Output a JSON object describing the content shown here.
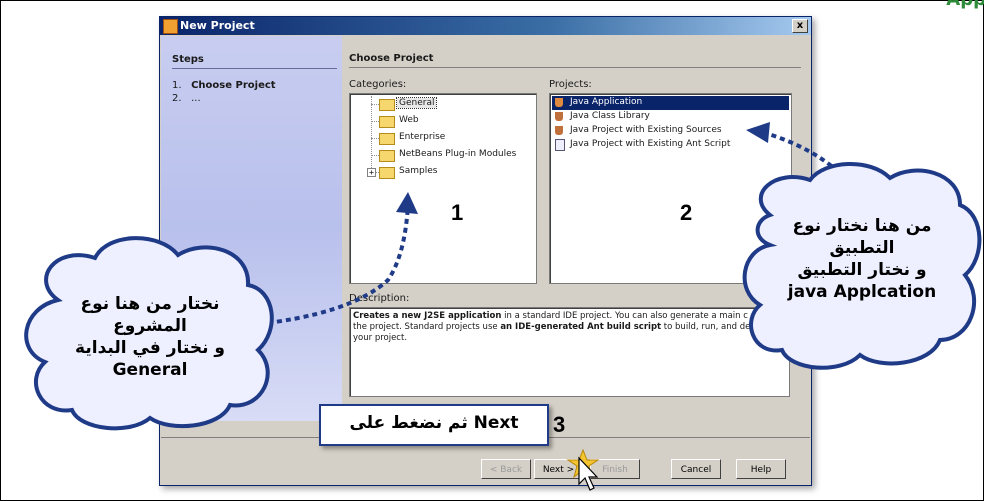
{
  "header_text": "App",
  "dialog": {
    "title": "New Project",
    "close_label": "x"
  },
  "steps": {
    "heading": "Steps",
    "items": [
      {
        "num": "1.",
        "label": "Choose Project"
      },
      {
        "num": "2.",
        "label": "..."
      }
    ]
  },
  "main": {
    "heading": "Choose Project",
    "categories_label": "Categories:",
    "projects_label": "Projects:",
    "description_label": "Description:"
  },
  "categories": [
    {
      "label": "General"
    },
    {
      "label": "Web"
    },
    {
      "label": "Enterprise"
    },
    {
      "label": "NetBeans Plug-in Modules"
    },
    {
      "label": "Samples"
    }
  ],
  "expander_symbol": "+",
  "projects": [
    {
      "label": "Java Application"
    },
    {
      "label": "Java Class Library"
    },
    {
      "label": "Java Project with Existing Sources"
    },
    {
      "label": "Java Project with Existing Ant Script"
    }
  ],
  "description": {
    "bold1": "Creates a new J2SE application",
    "text1": " in a standard IDE project. You can also generate a main c",
    "text2": "the project. Standard projects use ",
    "bold2": "an IDE-generated Ant build script",
    "text3": " to build, run, and debu",
    "text4": "your project."
  },
  "buttons": {
    "back": "< Back",
    "next": "Next >",
    "finish": "Finish",
    "cancel": "Cancel",
    "help": "Help"
  },
  "annotations": {
    "num1": "1",
    "num2": "2",
    "num3": "3",
    "left_cloud": {
      "line1": "نختار من هنا نوع",
      "line2": "المشروع",
      "line3": "و نختار في البداية",
      "line4": "General"
    },
    "right_cloud": {
      "line1": "من هنا نختار نوع",
      "line2": "التطبيق",
      "line3": "و نختار التطبيق",
      "line4": "java Applcation"
    },
    "next_callout": "ثم نضغط على Next"
  },
  "colors": {
    "titlebar": "#0a246a",
    "cloud_fill": "#eef0ff",
    "cloud_border": "#1f3b87",
    "arrow": "#1f3b87"
  }
}
